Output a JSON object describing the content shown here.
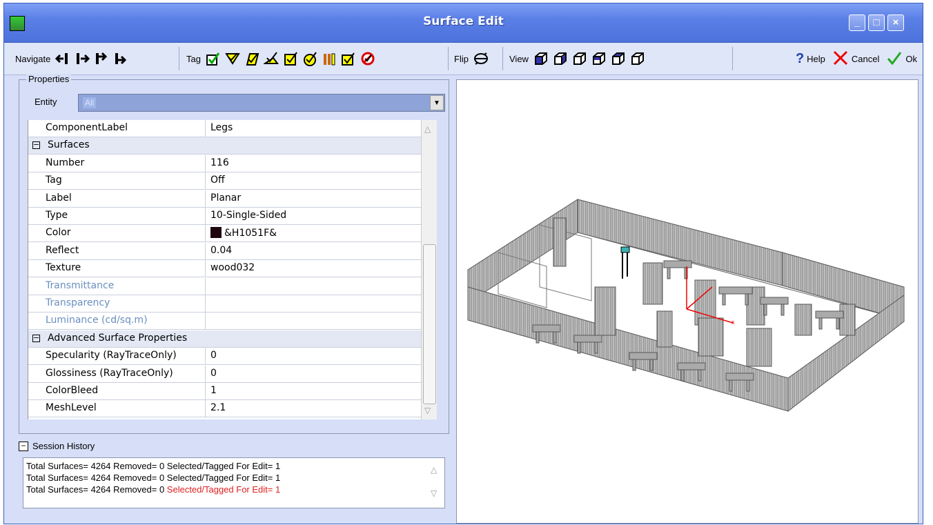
{
  "window": {
    "title": "Surface Edit"
  },
  "toolbar": {
    "navigate_label": "Navigate",
    "tag_label": "Tag",
    "flip_label": "Flip",
    "view_label": "View",
    "help_label": "Help",
    "cancel_label": "Cancel",
    "ok_label": "Ok"
  },
  "properties": {
    "legend": "Properties",
    "entity_label": "Entity",
    "entity_value": "All",
    "rows": [
      {
        "key": "ComponentLabel",
        "value": "Legs"
      },
      {
        "key": "Surfaces",
        "value": "",
        "category": true
      },
      {
        "key": "Number",
        "value": "116"
      },
      {
        "key": "Tag",
        "value": "Off"
      },
      {
        "key": "Label",
        "value": "Planar"
      },
      {
        "key": "Type",
        "value": "10-Single-Sided"
      },
      {
        "key": "Color",
        "value": "&H1051F&",
        "swatch": "#1F0510"
      },
      {
        "key": "Reflect",
        "value": "0.04"
      },
      {
        "key": "Texture",
        "value": "wood032"
      },
      {
        "key": "Transmittance",
        "value": "",
        "dim": true
      },
      {
        "key": "Transparency",
        "value": "",
        "dim": true
      },
      {
        "key": "Luminance (cd/sq.m)",
        "value": "",
        "dim": true
      },
      {
        "key": "Advanced Surface Properties",
        "value": "",
        "category": true
      },
      {
        "key": "Specularity (RayTraceOnly)",
        "value": "0"
      },
      {
        "key": "Glossiness (RayTraceOnly)",
        "value": "0"
      },
      {
        "key": "ColorBleed",
        "value": "1"
      },
      {
        "key": "MeshLevel",
        "value": "2.1"
      }
    ]
  },
  "session": {
    "legend": "Session History",
    "lines": [
      {
        "text": "Total Surfaces= 4264 Removed= 0 Selected/Tagged For Edit= 1",
        "highlight": ""
      },
      {
        "text": "Total Surfaces= 4264 Removed= 0 Selected/Tagged For Edit= 1",
        "highlight": ""
      },
      {
        "text": "Total Surfaces= 4264 Removed= 0 ",
        "highlight": "Selected/Tagged For Edit= 1"
      }
    ]
  },
  "colors": {
    "titlebar": "#5a7fe6",
    "dialog_bg": "#d6dff7",
    "highlight_text": "#e02020",
    "swatch": "#1F0510"
  },
  "icons": {
    "navigate": [
      "nav-first-icon",
      "nav-last-icon",
      "nav-prev-icon",
      "nav-next-icon"
    ],
    "tag": [
      "tag-check-1-icon",
      "tag-check-2-icon",
      "tag-check-3-icon",
      "tag-check-4-icon",
      "tag-check-5-icon",
      "tag-check-6-icon",
      "tag-check-7-icon",
      "tag-check-8-icon",
      "tag-clear-icon"
    ],
    "view": [
      "view-iso-1-icon",
      "view-iso-2-icon",
      "view-iso-3-icon",
      "view-iso-4-icon",
      "view-iso-5-icon",
      "view-iso-6-icon"
    ]
  }
}
